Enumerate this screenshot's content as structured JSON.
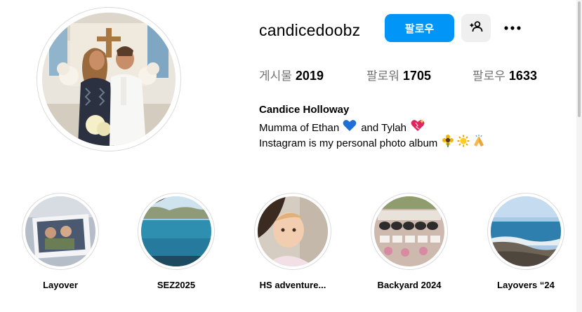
{
  "profile": {
    "username": "candicedoobz",
    "follow_label": "팔로우",
    "full_name": "Candice Holloway",
    "bio_line1_text_a": "Mumma of Ethan",
    "bio_line1_text_b": "and Tylah",
    "bio_line2_text": "Instagram is my personal photo album",
    "avatar_icon": "profile-photo-couple-church"
  },
  "stats": {
    "posts_label": "게시물",
    "posts_count": "2019",
    "followers_label": "팔로워",
    "followers_count": "1705",
    "following_label": "팔로우",
    "following_count": "1633"
  },
  "icons": {
    "suggest": "person-add-icon",
    "more": "more-options-icon",
    "bio_emoji_1": "blue-heart-emoji",
    "bio_emoji_2": "sparkling-heart-emoji",
    "bio_emoji_3": "sunflower-emoji",
    "bio_emoji_4": "sun-emoji",
    "bio_emoji_5": "praying-hands-emoji"
  },
  "colors": {
    "accent": "#0095f6",
    "secondary_button": "#efefef",
    "muted_text": "#737373"
  },
  "highlights": [
    {
      "label": "Layover"
    },
    {
      "label": "SEZ2025"
    },
    {
      "label": "HS adventure..."
    },
    {
      "label": "Backyard 2024"
    },
    {
      "label": "Layovers “24"
    }
  ]
}
